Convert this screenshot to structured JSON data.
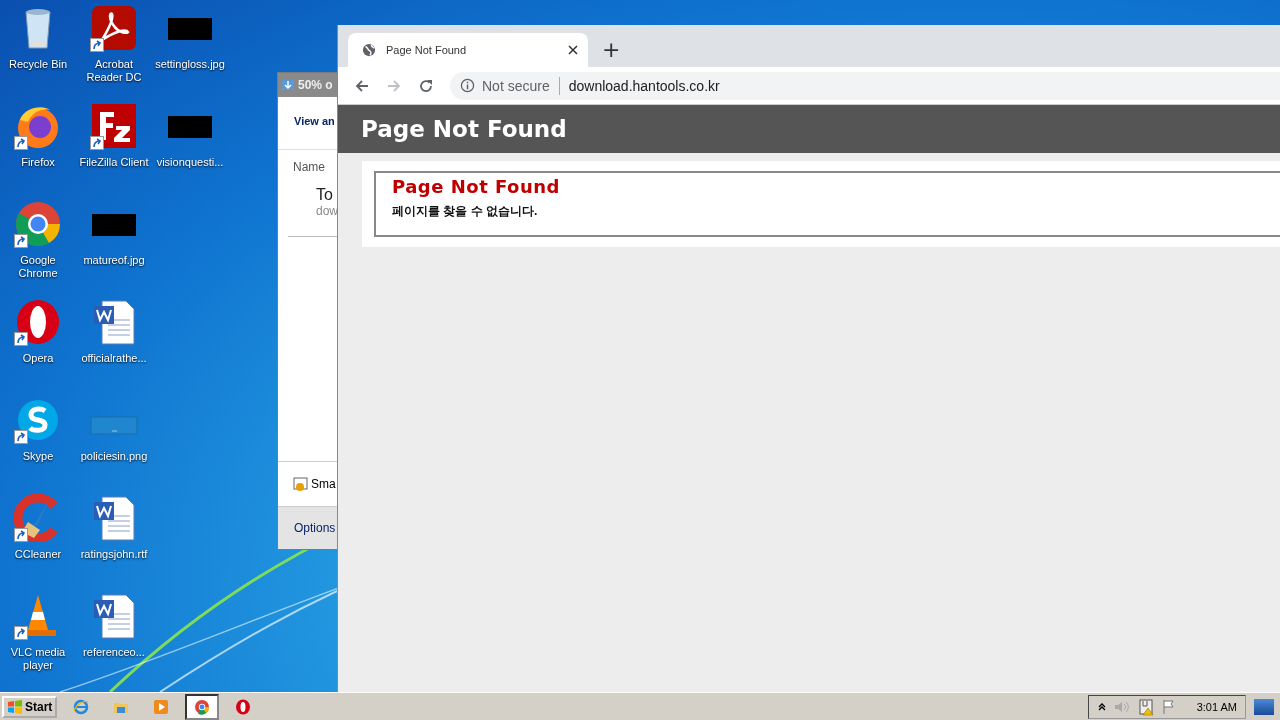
{
  "desktop": {
    "columns": [
      {
        "icons": [
          {
            "label": "Recycle Bin",
            "kind": "recycle",
            "shortcut": false
          },
          {
            "label": "Firefox",
            "kind": "firefox",
            "shortcut": true
          },
          {
            "label": "Google Chrome",
            "kind": "chrome",
            "shortcut": true
          },
          {
            "label": "Opera",
            "kind": "opera",
            "shortcut": true
          },
          {
            "label": "Skype",
            "kind": "skype",
            "shortcut": true
          },
          {
            "label": "CCleaner",
            "kind": "ccleaner",
            "shortcut": true
          },
          {
            "label": "VLC media player",
            "kind": "vlc",
            "shortcut": true
          }
        ]
      },
      {
        "icons": [
          {
            "label": "Acrobat Reader DC",
            "kind": "acrobat",
            "shortcut": true
          },
          {
            "label": "FileZilla Client",
            "kind": "filezilla",
            "shortcut": true
          },
          {
            "label": "matureof.jpg",
            "kind": "redacted",
            "shortcut": false
          },
          {
            "label": "officialrathe...",
            "kind": "word",
            "shortcut": false
          },
          {
            "label": "policiesin.png",
            "kind": "image",
            "shortcut": false
          },
          {
            "label": "ratingsjohn.rtf",
            "kind": "word",
            "shortcut": false
          },
          {
            "label": "referenceo...",
            "kind": "word",
            "shortcut": false
          }
        ]
      },
      {
        "icons": [
          {
            "label": "settingloss.jpg",
            "kind": "redacted",
            "shortcut": false
          },
          {
            "label": "visionquesti...",
            "kind": "redacted",
            "shortcut": false
          }
        ]
      }
    ]
  },
  "back_window": {
    "title": "50% o",
    "heading": "View an",
    "column_header": "Name",
    "item_title": "To",
    "item_subtitle": "dow",
    "footer_item": "Sma",
    "options_link": "Options"
  },
  "browser": {
    "tabs": [
      {
        "title": "Page Not Found",
        "selected": true
      }
    ],
    "new_tab": "+",
    "nav": {
      "forward_disabled": true
    },
    "security": "Not secure",
    "url": "download.hantools.co.kr",
    "page": {
      "header": "Page Not Found",
      "error_title": "Page Not Found",
      "error_message": "페이지를 찾을 수 없습니다."
    }
  },
  "taskbar": {
    "start": "Start",
    "items": [
      {
        "kind": "ie",
        "selected": false
      },
      {
        "kind": "explorer",
        "selected": false
      },
      {
        "kind": "media",
        "selected": false
      },
      {
        "kind": "chrome",
        "selected": true
      },
      {
        "kind": "opera",
        "selected": false
      }
    ],
    "clock": "3:01 AM"
  }
}
